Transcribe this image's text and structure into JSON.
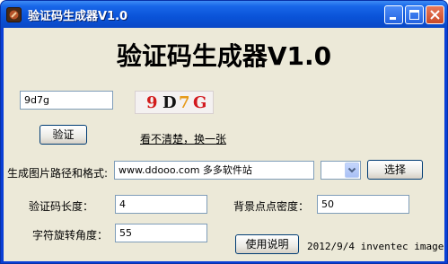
{
  "window": {
    "title": "验证码生成器V1.0",
    "icon": "app-icon",
    "controls": [
      "minimize-icon",
      "maximize-icon",
      "close-icon"
    ]
  },
  "header": {
    "title": "验证码生成器V1.0"
  },
  "verify": {
    "input_value": "9d7g",
    "button_label": "验证",
    "captcha_chars": [
      "9",
      "D",
      "7",
      "G"
    ],
    "captcha_colors": [
      "#d21b1b",
      "#111111",
      "#e69a1a",
      "#d2181f"
    ],
    "refresh_link": "看不清楚，换一张"
  },
  "settings": {
    "path_label": "生成图片路径和格式:",
    "path_value": "www.ddooo.com 多多软件站",
    "browse_button": "选择",
    "length_label": "验证码长度：",
    "length_value": "4",
    "density_label": "背景点点密度：",
    "density_value": "50",
    "rotation_label": "字符旋转角度：",
    "rotation_value": "55",
    "help_button": "使用说明"
  },
  "footer": {
    "credit": "2012/9/4 inventec image"
  }
}
